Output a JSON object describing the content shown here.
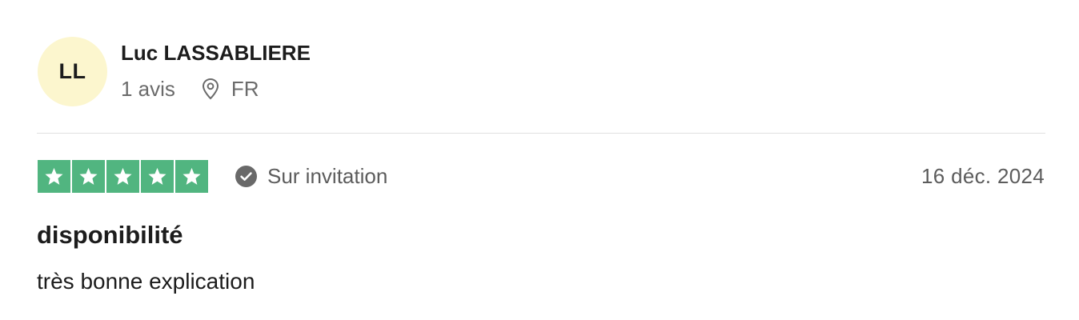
{
  "reviewer": {
    "initials": "LL",
    "name": "Luc LASSABLIERE",
    "review_count": "1 avis",
    "location_icon": "location-pin-icon",
    "country": "FR",
    "avatar_color": "#fcf6ce"
  },
  "review": {
    "rating": 5,
    "rating_max": 5,
    "star_color": "#51b580",
    "verification_icon": "check-circle-icon",
    "verification_label": "Sur invitation",
    "date": "16 déc. 2024",
    "title": "disponibilité",
    "body": "très bonne explication"
  }
}
